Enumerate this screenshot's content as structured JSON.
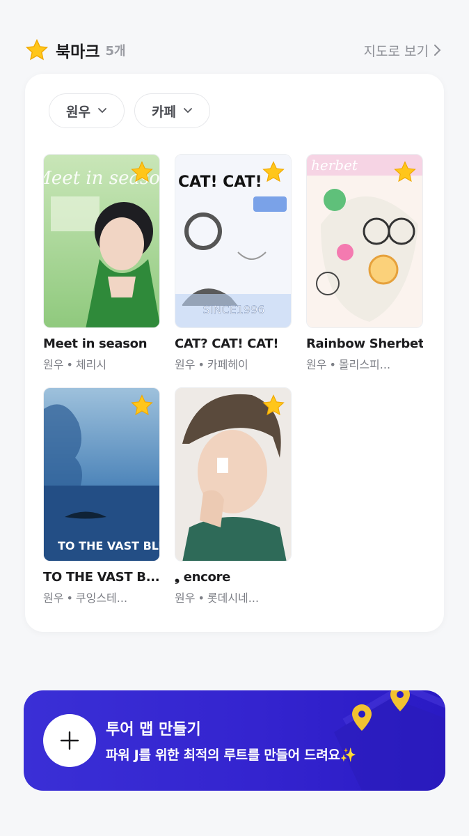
{
  "header": {
    "title": "북마크",
    "count": "5개",
    "map_link": "지도로 보기",
    "icon": "star-icon"
  },
  "filters": [
    {
      "label": "원우"
    },
    {
      "label": "카페"
    }
  ],
  "items": [
    {
      "title": "Meet in season",
      "artist": "원우",
      "place": "체리시",
      "poster_text": "Meet in season"
    },
    {
      "title": "CAT? CAT! CAT!",
      "artist": "원우",
      "place": "카페헤이",
      "poster_text": "CAT! CAT!",
      "poster_sub": "SINCE1996"
    },
    {
      "title": "Rainbow Sherbet",
      "artist": "원우",
      "place": "몰리스피...",
      "poster_text": "herbet"
    },
    {
      "title": "TO THE VAST B...",
      "artist": "원우",
      "place": "쿠잉스테...",
      "poster_text": "TO THE VAST BLUE"
    },
    {
      "title": "❟ encore",
      "artist": "원우",
      "place": "롯데시네...",
      "poster_text": ""
    }
  ],
  "separator": "•",
  "banner": {
    "title": "투어 맵 만들기",
    "subtitle": "파워 J를 위한 최적의 루트를 만들어 드려요✨"
  },
  "colors": {
    "accent": "#3424cf",
    "star": "#ffc61a",
    "pin": "#f2c230"
  }
}
